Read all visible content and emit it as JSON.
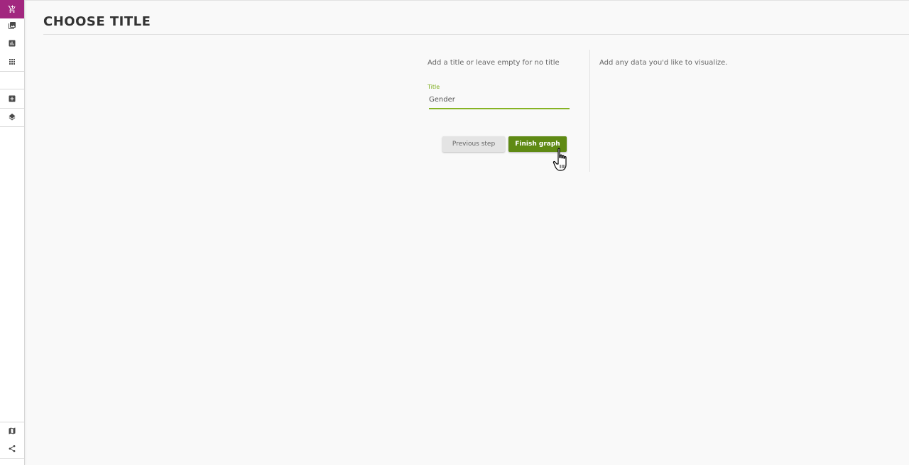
{
  "page": {
    "title": "CHOOSE TITLE"
  },
  "sidebar": {
    "accent_color": "#a2277f",
    "items": [
      {
        "icon": "cart-icon",
        "active": true
      },
      {
        "icon": "image-icon",
        "active": false
      },
      {
        "icon": "bar-chart-icon",
        "active": false
      },
      {
        "icon": "grid-icon",
        "active": false
      },
      {
        "icon": "add-box-icon",
        "active": false
      },
      {
        "icon": "layers-icon",
        "active": false
      },
      {
        "icon": "map-icon",
        "active": false
      },
      {
        "icon": "share-icon",
        "active": false
      }
    ]
  },
  "title_step": {
    "hint": "Add a title or leave empty for no title",
    "field_label": "Title",
    "field_value": "Gender",
    "previous_label": "Previous step",
    "finish_label": "Finish graph",
    "accent_color": "#5f8a14"
  },
  "preview": {
    "hint": "Add any data you'd like to visualize."
  }
}
